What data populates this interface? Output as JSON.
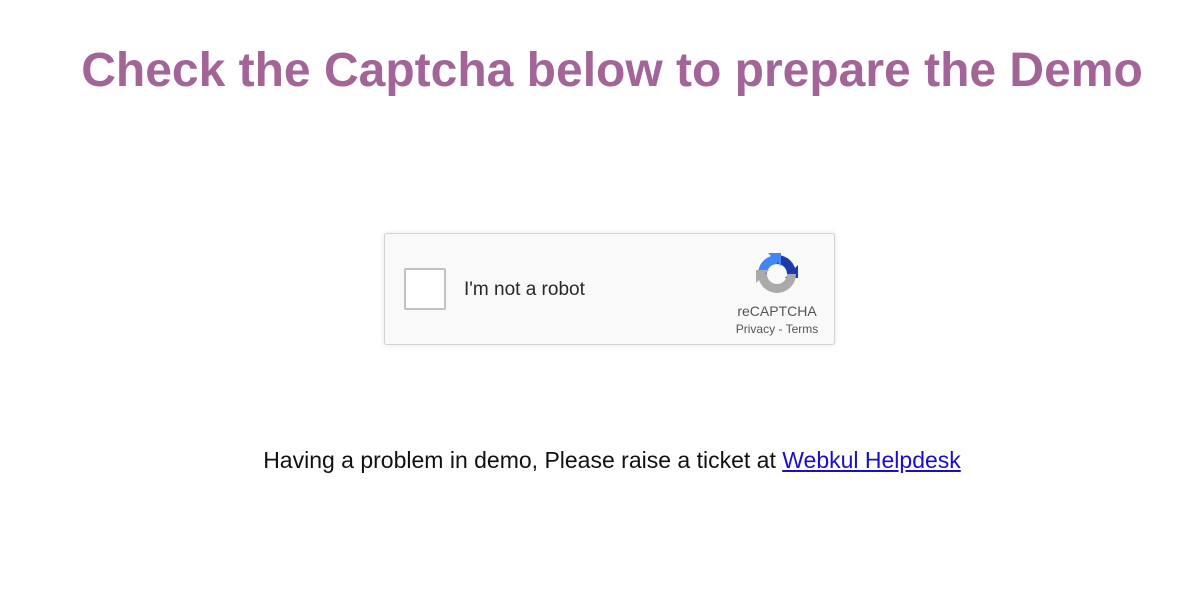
{
  "header": {
    "title": "Check the Captcha below to prepare the Demo"
  },
  "captcha": {
    "checkbox_label": "I'm not a robot",
    "brand": "reCAPTCHA",
    "privacy_link": "Privacy",
    "separator": " - ",
    "terms_link": "Terms",
    "logo_icon": "recaptcha-logo-icon",
    "colors": {
      "logo_blue_dark": "#1c3aa9",
      "logo_blue_light": "#4285f4",
      "logo_gray": "#aaaaaa",
      "box_border": "#c1c1c1"
    }
  },
  "help": {
    "text": "Having a problem in demo, Please raise a ticket at ",
    "link_label": "Webkul Helpdesk"
  },
  "theme": {
    "title_color": "#a36597",
    "link_color": "#1a0dcc"
  }
}
